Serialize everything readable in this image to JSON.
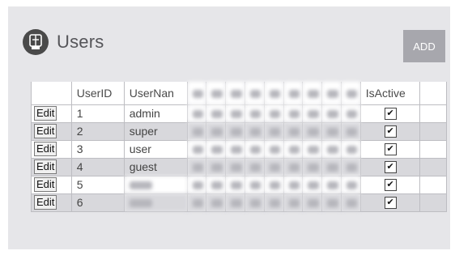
{
  "header": {
    "title": "Users",
    "add_label": "ADD"
  },
  "table": {
    "columns": [
      "",
      "UserID",
      "UserNan",
      "",
      "",
      "",
      "",
      "",
      "",
      "",
      "",
      "",
      "IsActive",
      ""
    ],
    "edit_label": "Edit",
    "rows": [
      {
        "id": "1",
        "name": "admin",
        "active": true
      },
      {
        "id": "2",
        "name": "super",
        "active": true
      },
      {
        "id": "3",
        "name": "user",
        "active": true
      },
      {
        "id": "4",
        "name": "guest",
        "active": true
      },
      {
        "id": "5",
        "name": "",
        "active": true
      },
      {
        "id": "6",
        "name": "",
        "active": true
      }
    ]
  },
  "colors": {
    "panel": "#e6e6e9",
    "add_button": "#a7a7ad",
    "icon": "#4a4a4a"
  }
}
